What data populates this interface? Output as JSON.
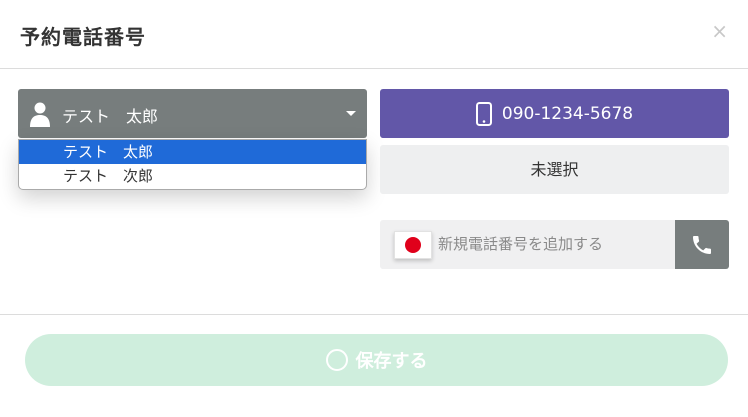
{
  "modal": {
    "title": "予約電話番号",
    "close_label": "×"
  },
  "customer_select": {
    "value": "テスト　太郎",
    "icon": "user-icon",
    "options": [
      {
        "label": "テスト　太郎",
        "selected": true
      },
      {
        "label": "テスト　次郎",
        "selected": false
      }
    ]
  },
  "phone_button": {
    "number": "090-1234-5678",
    "icon": "mobile-phone-icon",
    "color": "#6257a8"
  },
  "unselected_label": "未選択",
  "new_phone": {
    "country_flag": "japan-flag-icon",
    "placeholder": "新規電話番号を追加する",
    "value": "",
    "call_icon": "phone-icon"
  },
  "save_button": {
    "label": "保存する",
    "color": "#cfeedd"
  }
}
